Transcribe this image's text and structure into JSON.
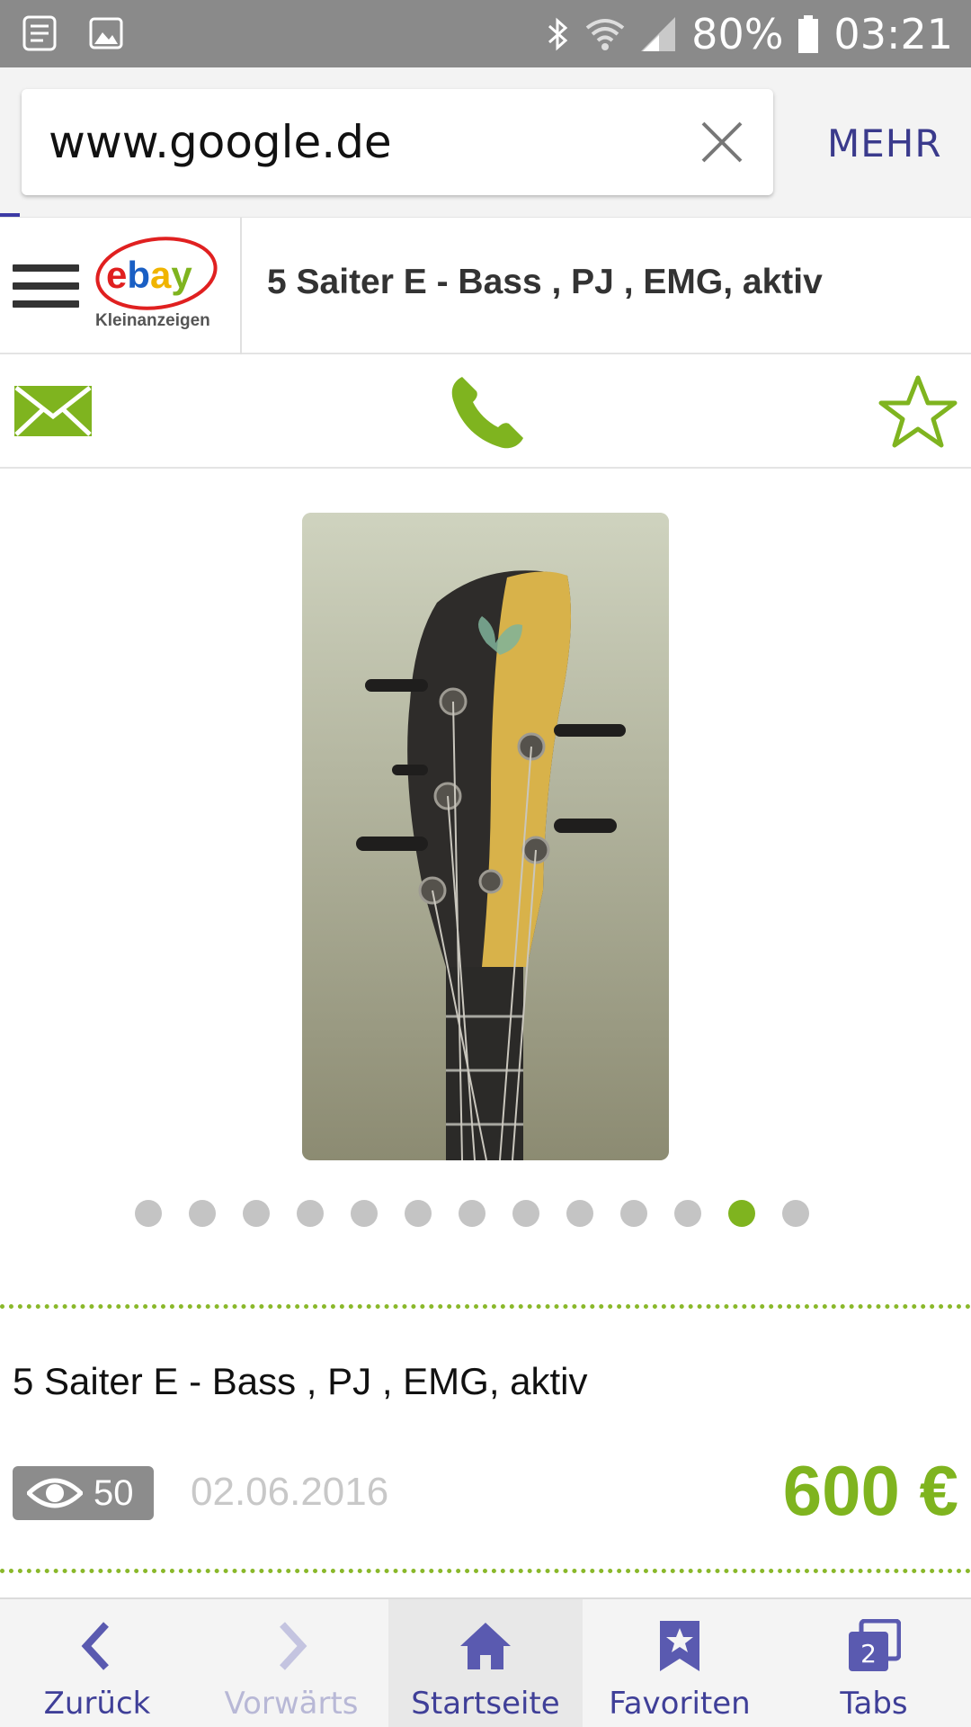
{
  "status_bar": {
    "battery": "80%",
    "time": "03:21"
  },
  "browser": {
    "url": "www.google.de",
    "more_label": "MEHR"
  },
  "site": {
    "logo_word": "ebay",
    "logo_sub": "Kleinanzeigen",
    "header_title": "5 Saiter E - Bass , PJ , EMG, aktiv"
  },
  "gallery": {
    "total_images": 13,
    "active_index": 11
  },
  "listing": {
    "title": "5 Saiter E - Bass , PJ , EMG, aktiv",
    "views": "50",
    "date": "02.06.2016",
    "price": "600 €"
  },
  "bottom_nav": {
    "back": "Zurück",
    "forward": "Vorwärts",
    "home": "Startseite",
    "favorites": "Favoriten",
    "tabs": "Tabs",
    "tabs_count": "2"
  },
  "colors": {
    "accent_green": "#7fb41f",
    "browser_purple": "#3f3f98",
    "status_gray": "#8a8a8a"
  }
}
